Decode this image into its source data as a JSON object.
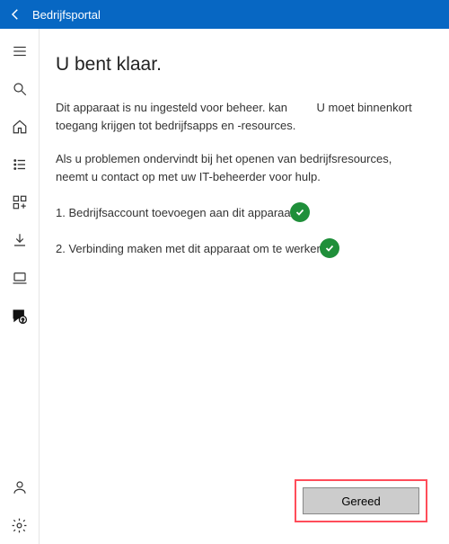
{
  "header": {
    "title": "Bedrijfsportal"
  },
  "content": {
    "heading": "U bent klaar.",
    "paragraph1_a": "Dit apparaat is nu ingesteld voor beheer. kan",
    "paragraph1_b": "U moet binnenkort toegang krijgen tot bedrijfsapps en -resources.",
    "paragraph2": "Als u problemen ondervindt bij het openen van bedrijfsresources, neemt u contact op met uw IT-beheerder voor hulp.",
    "steps": [
      {
        "text": "1. Bedrijfsaccount toevoegen aan dit apparaat"
      },
      {
        "text": "2. Verbinding maken met dit apparaat om te werken"
      }
    ],
    "done_label": "Gereed"
  }
}
